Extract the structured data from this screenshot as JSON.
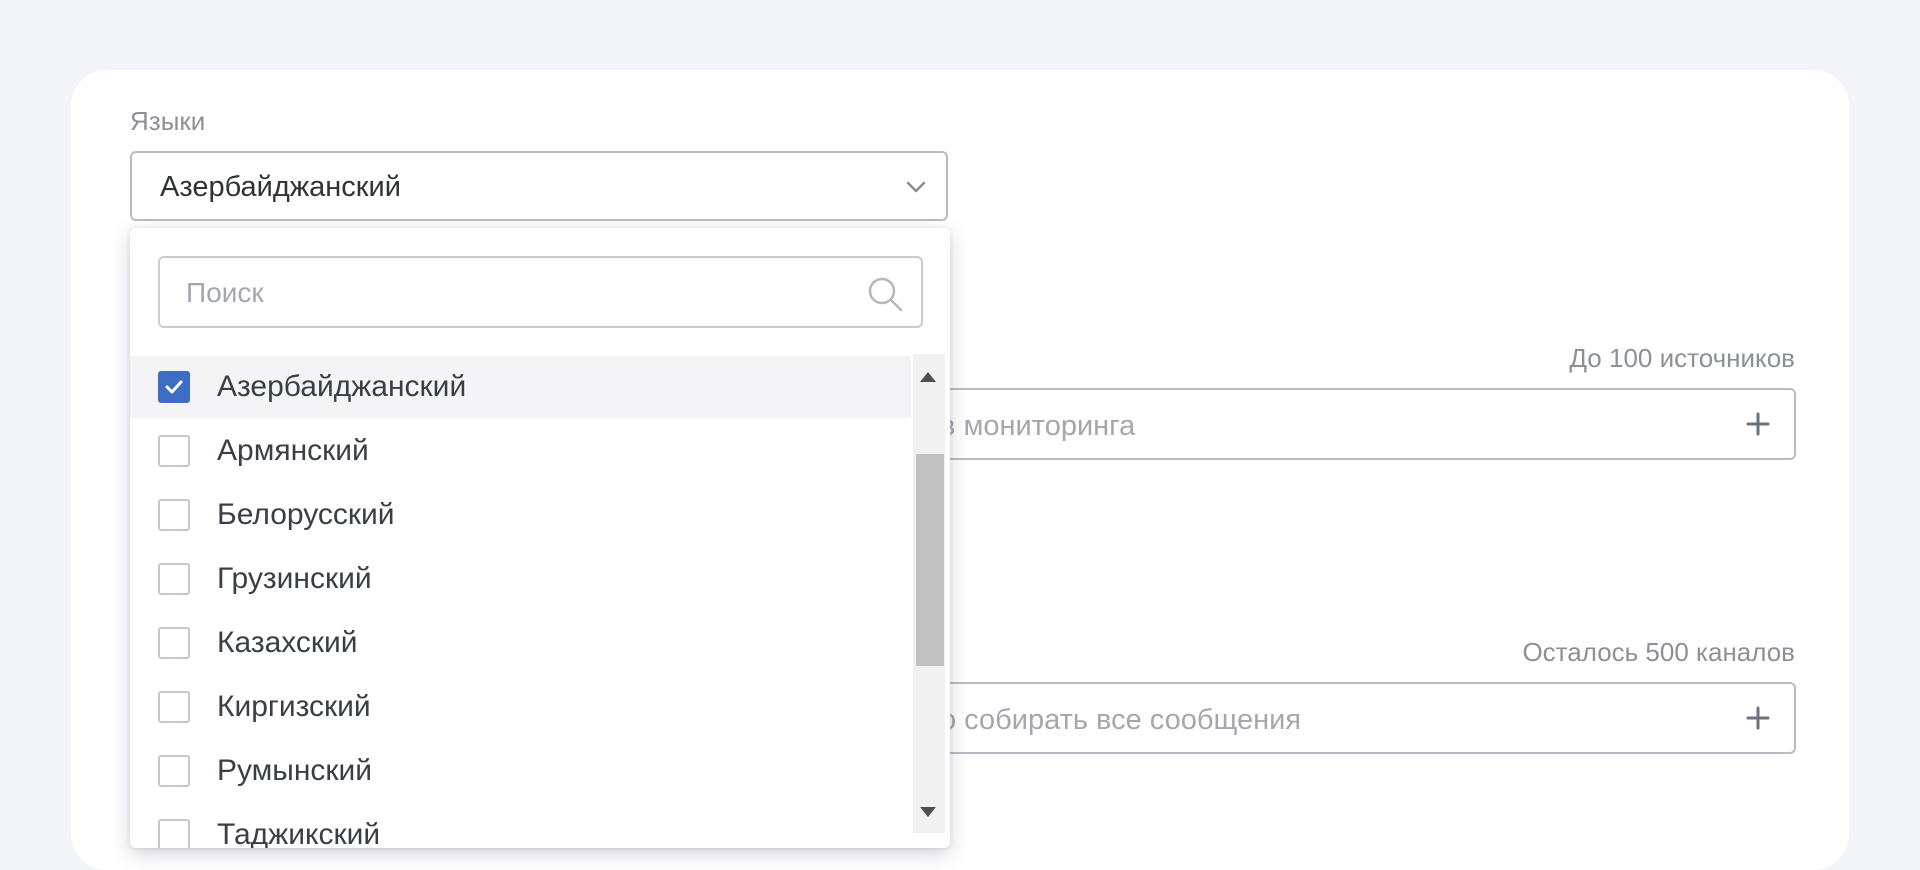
{
  "languages": {
    "label": "Языки",
    "selected_value": "Азербайджанский"
  },
  "dropdown": {
    "search_placeholder": "Поиск",
    "options": [
      {
        "label": "Азербайджанский",
        "checked": true
      },
      {
        "label": "Армянский",
        "checked": false
      },
      {
        "label": "Белорусский",
        "checked": false
      },
      {
        "label": "Грузинский",
        "checked": false
      },
      {
        "label": "Казахский",
        "checked": false
      },
      {
        "label": "Киргизский",
        "checked": false
      },
      {
        "label": "Румынский",
        "checked": false
      },
      {
        "label": "Таджикский",
        "checked": false
      }
    ]
  },
  "sources": {
    "limit_hint": "До 100 источников",
    "placeholder_visible": "в мониторинга"
  },
  "channels": {
    "limit_hint": "Осталось 500 каналов",
    "placeholder_visible": "о собирать все сообщения"
  },
  "colors": {
    "accent": "#3e6ec3",
    "border": "#b9bcc6",
    "muted_text": "#8d9099"
  },
  "icons": {
    "select_chevron": "chevron-down-icon",
    "search": "search-icon",
    "add": "plus-icon",
    "check": "check-icon"
  }
}
